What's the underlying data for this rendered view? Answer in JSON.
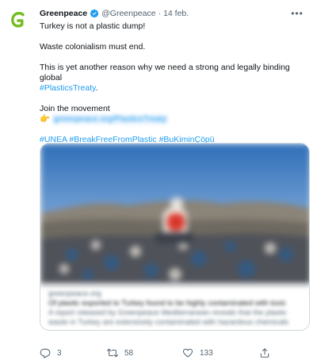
{
  "tweet": {
    "author_name": "Greenpeace",
    "handle": "@Greenpeace",
    "separator": "·",
    "date": "14 feb.",
    "more_label": "•••",
    "lines": {
      "l1": "Turkey is not a plastic dump!",
      "l2": "Waste colonialism must end.",
      "l3a": "This is yet another reason why we need a strong and legally binding global",
      "l3b": "#PlasticsTreaty",
      "l3c": ".",
      "l4": "Join the movement",
      "l5_emoji": "👉",
      "l5_link": "greenpeace.org/PlasticsTreaty",
      "l6_tag1": "#UNEA",
      "l6_tag2": "#BreakFreeFromPlastic",
      "l6_tag3": "#BuKiminÇöpü"
    }
  },
  "card": {
    "domain": "greenpeace.org",
    "title": "Of plastic exported to Turkey found to be highly contaminated with toxic",
    "description": "A report released by Greenpeace Mediterranean reveals that the plastic",
    "description2": "waste in Turkey are extensively contaminated with hazardous chemicals"
  },
  "actions": {
    "reply_count": "3",
    "retweet_count": "58",
    "like_count": "133"
  },
  "colors": {
    "brand_green": "#73be1e",
    "accent_blue": "#1d9bf0",
    "muted": "#536471",
    "text": "#0f1419",
    "border": "#cfd9de"
  },
  "icons": {
    "avatar": "greenpeace-logo-icon",
    "verified": "verified-badge-icon",
    "more": "more-options-icon",
    "reply": "reply-icon",
    "retweet": "retweet-icon",
    "like": "heart-icon",
    "share": "share-icon"
  }
}
